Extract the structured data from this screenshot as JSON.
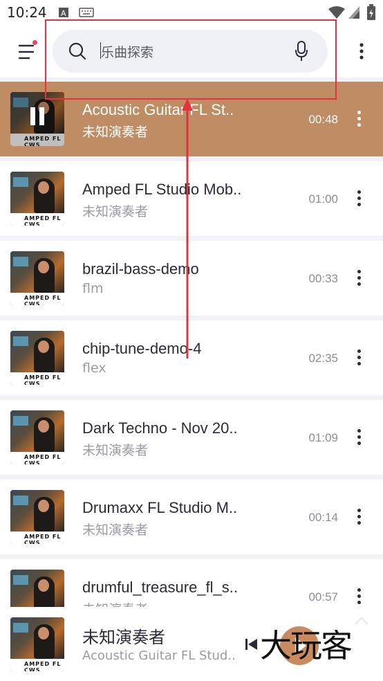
{
  "status_bar": {
    "time": "10:24"
  },
  "header": {
    "search": {
      "placeholder": "乐曲探索"
    },
    "icons": {
      "menu": "hamburger-menu-icon",
      "search": "search-icon",
      "mic": "microphone-icon",
      "more": "more-vertical-icon"
    }
  },
  "annotation": {
    "color": "#e1323d"
  },
  "tracks": [
    {
      "title": "Acoustic Guitar FL St..",
      "artist": "未知演奏者",
      "duration": "00:48",
      "playing": true
    },
    {
      "title": "Amped FL Studio Mob..",
      "artist": "未知演奏者",
      "duration": "01:00"
    },
    {
      "title": "brazil-bass-demo",
      "artist": "flm",
      "duration": "00:33"
    },
    {
      "title": "chip-tune-demo-4",
      "artist": "flex",
      "duration": "02:35"
    },
    {
      "title": "Dark Techno - Nov 20..",
      "artist": "未知演奏者",
      "duration": "01:09"
    },
    {
      "title": "Drumaxx FL Studio M..",
      "artist": "未知演奏者",
      "duration": "00:14"
    },
    {
      "title": "drumful_treasure_fl_s..",
      "artist": "未知演奏者",
      "duration": "00:57"
    }
  ],
  "album_art_text": "AMPED FL CWS",
  "now_playing": {
    "title": "未知演奏者",
    "subtitle": "Acoustic Guitar FL Stud..",
    "accent": "#c98a5f"
  },
  "watermark": "大玩客",
  "colors": {
    "playing_row": "#bf8c63"
  }
}
